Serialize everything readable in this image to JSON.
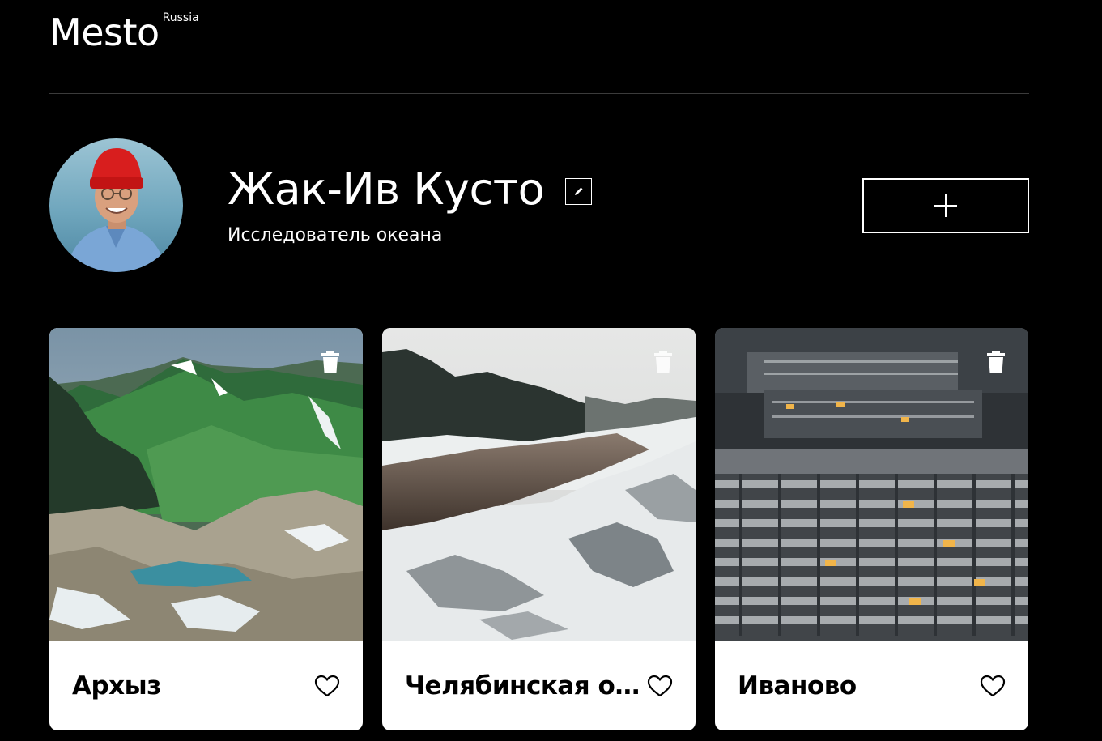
{
  "header": {
    "logo_word": "Mesto",
    "logo_suffix": "Russia"
  },
  "profile": {
    "name": "Жак-Ив Кусто",
    "about": "Исследователь океана",
    "avatar_icon": "avatar-photo",
    "edit_icon": "pencil-icon",
    "add_icon": "plus-icon"
  },
  "cards": [
    {
      "title": "Архыз",
      "image": "mountain-lake-landscape",
      "like_icon": "heart-outline-icon",
      "delete_icon": "trash-icon"
    },
    {
      "title": "Челябинская об…",
      "image": "snowy-river-landscape",
      "like_icon": "heart-outline-icon",
      "delete_icon": "trash-icon"
    },
    {
      "title": "Иваново",
      "image": "apartment-blocks-city",
      "like_icon": "heart-outline-icon",
      "delete_icon": "trash-icon"
    }
  ],
  "colors": {
    "background": "#000000",
    "card_background": "#ffffff",
    "card_text": "#000000",
    "header_divider": "#545454"
  }
}
